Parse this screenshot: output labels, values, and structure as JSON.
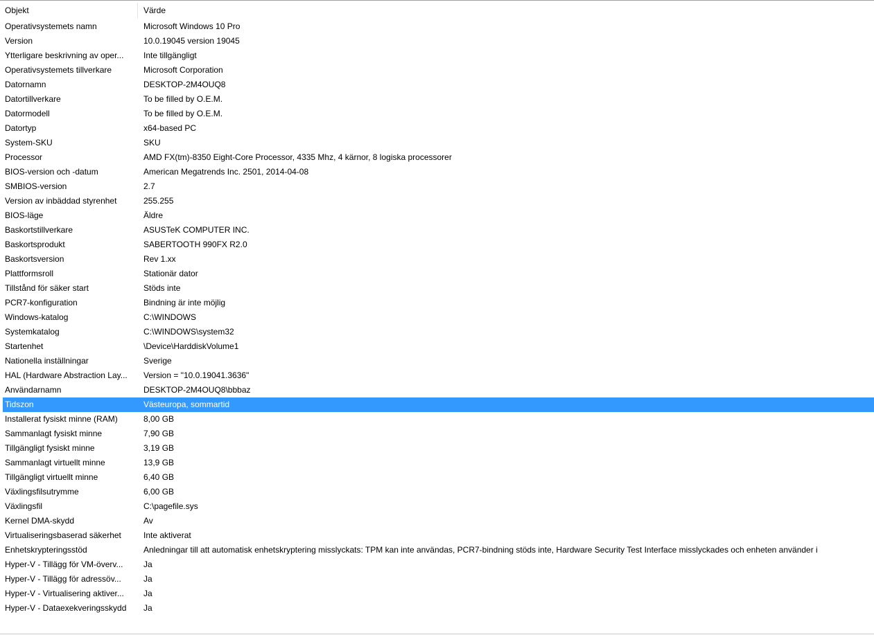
{
  "header": {
    "col_object": "Objekt",
    "col_value": "Värde"
  },
  "rows": [
    {
      "name": "Operativsystemets namn",
      "value": "Microsoft Windows 10 Pro"
    },
    {
      "name": "Version",
      "value": "10.0.19045 version 19045"
    },
    {
      "name": "Ytterligare beskrivning av oper...",
      "value": "Inte tillgängligt"
    },
    {
      "name": "Operativsystemets tillverkare",
      "value": "Microsoft Corporation"
    },
    {
      "name": "Datornamn",
      "value": "DESKTOP-2M4OUQ8"
    },
    {
      "name": "Datortillverkare",
      "value": "To be filled by O.E.M."
    },
    {
      "name": "Datormodell",
      "value": "To be filled by O.E.M."
    },
    {
      "name": "Datortyp",
      "value": "x64-based PC"
    },
    {
      "name": "System-SKU",
      "value": "SKU"
    },
    {
      "name": "Processor",
      "value": "AMD FX(tm)-8350 Eight-Core Processor, 4335 Mhz, 4 kärnor, 8 logiska processorer"
    },
    {
      "name": "BIOS-version och -datum",
      "value": "American Megatrends Inc. 2501, 2014-04-08"
    },
    {
      "name": "SMBIOS-version",
      "value": "2.7"
    },
    {
      "name": "Version av inbäddad styrenhet",
      "value": "255.255"
    },
    {
      "name": "BIOS-läge",
      "value": "Äldre"
    },
    {
      "name": "Baskortstillverkare",
      "value": "ASUSTeK COMPUTER INC."
    },
    {
      "name": "Baskortsprodukt",
      "value": "SABERTOOTH 990FX R2.0"
    },
    {
      "name": "Baskortsversion",
      "value": "Rev 1.xx"
    },
    {
      "name": "Plattformsroll",
      "value": "Stationär dator"
    },
    {
      "name": "Tillstånd för säker start",
      "value": "Stöds inte"
    },
    {
      "name": "PCR7-konfiguration",
      "value": "Bindning är inte möjlig"
    },
    {
      "name": "Windows-katalog",
      "value": "C:\\WINDOWS"
    },
    {
      "name": "Systemkatalog",
      "value": "C:\\WINDOWS\\system32"
    },
    {
      "name": "Startenhet",
      "value": "\\Device\\HarddiskVolume1"
    },
    {
      "name": "Nationella inställningar",
      "value": "Sverige"
    },
    {
      "name": "HAL (Hardware Abstraction Lay...",
      "value": "Version = \"10.0.19041.3636\""
    },
    {
      "name": "Användarnamn",
      "value": "DESKTOP-2M4OUQ8\\bbbaz"
    },
    {
      "name": "Tidszon",
      "value": "Västeuropa, sommartid",
      "selected": true
    },
    {
      "name": "Installerat fysiskt minne (RAM)",
      "value": "8,00 GB"
    },
    {
      "name": "Sammanlagt fysiskt minne",
      "value": "7,90 GB"
    },
    {
      "name": "Tillgängligt fysiskt minne",
      "value": "3,19 GB"
    },
    {
      "name": "Sammanlagt virtuellt minne",
      "value": "13,9 GB"
    },
    {
      "name": "Tillgängligt virtuellt minne",
      "value": "6,40 GB"
    },
    {
      "name": "Växlingsfilsutrymme",
      "value": "6,00 GB"
    },
    {
      "name": "Växlingsfil",
      "value": "C:\\pagefile.sys"
    },
    {
      "name": "Kernel DMA-skydd",
      "value": "Av"
    },
    {
      "name": "Virtualiseringsbaserad säkerhet",
      "value": "Inte aktiverat"
    },
    {
      "name": "Enhetskrypteringsstöd",
      "value": "Anledningar till att automatisk enhetskryptering misslyckats: TPM kan inte användas, PCR7-bindning stöds inte, Hardware Security Test Interface misslyckades och enheten använder i"
    },
    {
      "name": "Hyper-V - Tillägg för VM-överv...",
      "value": "Ja"
    },
    {
      "name": "Hyper-V - Tillägg för adressöv...",
      "value": "Ja"
    },
    {
      "name": "Hyper-V - Virtualisering aktiver...",
      "value": "Ja"
    },
    {
      "name": "Hyper-V - Dataexekveringsskydd",
      "value": "Ja"
    }
  ],
  "colors": {
    "selection": "#3399ff",
    "header_divider": "#e5e5e5"
  }
}
